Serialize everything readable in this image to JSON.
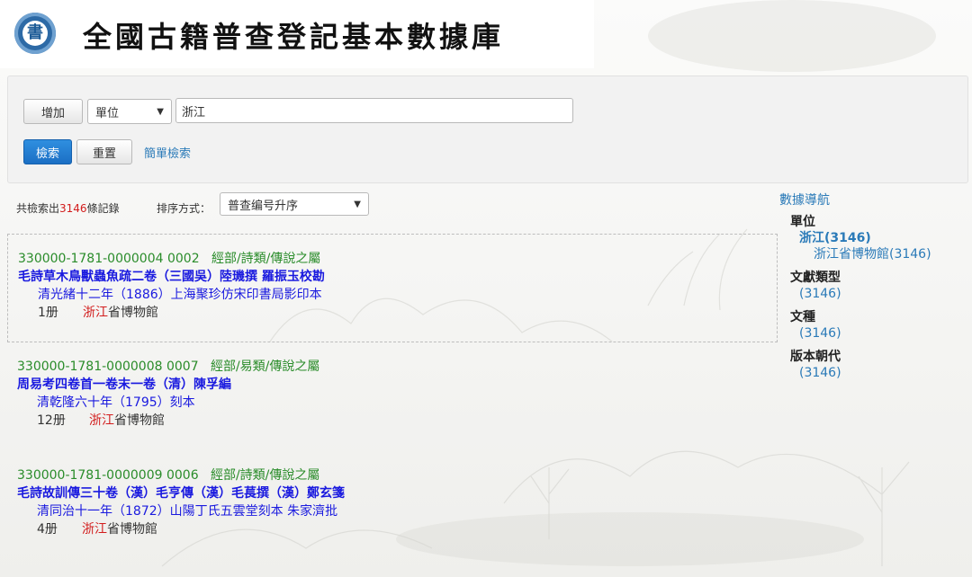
{
  "header": {
    "logo_glyph": "書",
    "site_title": "全國古籍普查登記基本數據庫"
  },
  "search": {
    "add_label": "增加",
    "field_select": "單位",
    "query_value": "浙江",
    "search_label": "檢索",
    "reset_label": "重置",
    "simple_link": "簡單檢索"
  },
  "summary": {
    "prefix": "共檢索出",
    "count": "3146",
    "suffix": "條記錄"
  },
  "sort": {
    "label": "排序方式：",
    "selected": "普查编号升序"
  },
  "records": [
    {
      "id": "330000-1781-0000004 0002",
      "category": "經部/詩類/傳說之屬",
      "title": "毛詩草木鳥獸蟲魚疏二卷（三國吳）陸璣撰 羅振玉校勘",
      "edition": "清光緒十二年（1886）上海聚珍仿宋印書局影印本",
      "quantity": "1册",
      "holder_highlight": "浙江",
      "holder_rest": "省博物館"
    },
    {
      "id": "330000-1781-0000008 0007",
      "category": "經部/易類/傳說之屬",
      "title": "周易考四卷首一卷末一卷（清）陳孚編",
      "edition": "清乾隆六十年（1795）刻本",
      "quantity": "12册",
      "holder_highlight": "浙江",
      "holder_rest": "省博物館"
    },
    {
      "id": "330000-1781-0000009 0006",
      "category": "經部/詩類/傳說之屬",
      "title": "毛詩故訓傳三十卷（漢）毛亨傳（漢）毛萇撰（漢）鄭玄箋",
      "edition": "清同治十一年（1872）山陽丁氏五雲堂刻本 朱家濟批",
      "quantity": "4册",
      "holder_highlight": "浙江",
      "holder_rest": "省博物館"
    }
  ],
  "nav": {
    "title": "數據導航",
    "unit_head": "單位",
    "unit_item": "浙江(3146)",
    "unit_sub": "浙江省博物館(3146)",
    "doctype_head": "文獻類型",
    "doctype_item": "(3146)",
    "lang_head": "文種",
    "lang_item": "(3146)",
    "dynasty_head": "版本朝代",
    "dynasty_item": "(3146)"
  },
  "colors": {
    "accent": "#2a7ab8",
    "primary": "#1b6fc4",
    "category": "#2a8c2a",
    "title": "#1a1adf",
    "highlight": "#d21c1c"
  }
}
